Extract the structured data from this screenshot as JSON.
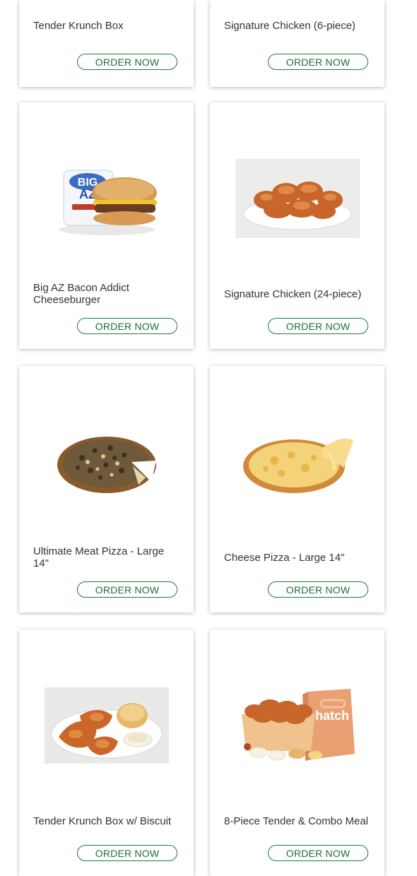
{
  "colors": {
    "accent": "#1f7a3e",
    "card_bg": "#ffffff",
    "text": "#333333"
  },
  "cards": [
    {
      "title": "Tender Krunch Box",
      "button": "ORDER NOW",
      "image": "chicken-tender-box"
    },
    {
      "title": "Signature Chicken (6-piece)",
      "button": "ORDER NOW",
      "image": "fried-chicken"
    },
    {
      "title": "Big AZ Bacon Addict Cheeseburger",
      "button": "ORDER NOW",
      "image": "cheeseburger"
    },
    {
      "title": "Signature Chicken (24-piece)",
      "button": "ORDER NOW",
      "image": "fried-chicken-platter"
    },
    {
      "title": "Ultimate Meat Pizza - Large 14\"",
      "button": "ORDER NOW",
      "image": "meat-pizza"
    },
    {
      "title": "Cheese Pizza - Large 14\"",
      "button": "ORDER NOW",
      "image": "cheese-pizza"
    },
    {
      "title": "Tender Krunch Box w/ Biscuit",
      "button": "ORDER NOW",
      "image": "tenders-with-biscuit"
    },
    {
      "title": "8-Piece Tender & Combo Meal",
      "button": "ORDER NOW",
      "image": "combo-meal-bag"
    }
  ]
}
